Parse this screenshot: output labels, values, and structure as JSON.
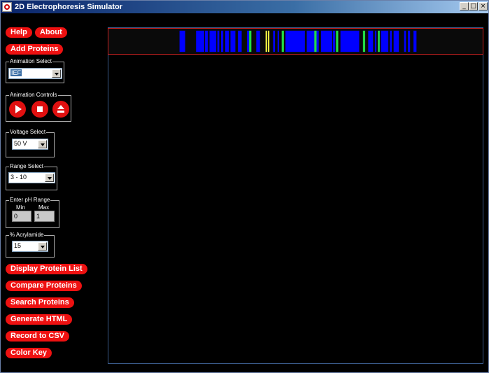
{
  "window": {
    "title": "2D Electrophoresis Simulator",
    "controls": {
      "minimize": "_",
      "maximize": "□",
      "close": "×"
    }
  },
  "sidebar": {
    "help": "Help",
    "about": "About",
    "add_proteins": "Add Proteins",
    "animation_select": {
      "label": "Animation Select",
      "value": "IEF"
    },
    "animation_controls": {
      "label": "Animation Controls",
      "play_icon": "play-icon",
      "stop_icon": "stop-icon",
      "eject_icon": "eject-icon"
    },
    "voltage_select": {
      "label": "Voltage Select",
      "value": "50 V"
    },
    "range_select": {
      "label": "Range Select",
      "value": "3 - 10"
    },
    "ph_range": {
      "label": "Enter pH Range",
      "min_label": "Min",
      "max_label": "Max",
      "min_value": "0",
      "max_value": "1"
    },
    "acrylamide": {
      "label": "% Acrylamide",
      "value": "15"
    },
    "buttons": [
      "Display Protein List",
      "Compare Proteins",
      "Search Proteins",
      "Generate HTML",
      "Record to CSV",
      "Color Key"
    ]
  },
  "colors": {
    "accent_button": "#ee1111",
    "band_blue": "#0000ff",
    "band_green": "#22dd44",
    "band_yellow": "#ffff44",
    "strip_border": "#cc2222"
  },
  "strip_bands": [
    {
      "pos": 0.19,
      "w": 0.015,
      "color": "blue"
    },
    {
      "pos": 0.234,
      "w": 0.022,
      "color": "blue"
    },
    {
      "pos": 0.258,
      "w": 0.008,
      "color": "blue"
    },
    {
      "pos": 0.27,
      "w": 0.018,
      "color": "blue"
    },
    {
      "pos": 0.291,
      "w": 0.005,
      "color": "blue"
    },
    {
      "pos": 0.301,
      "w": 0.006,
      "color": "blue"
    },
    {
      "pos": 0.312,
      "w": 0.01,
      "color": "blue"
    },
    {
      "pos": 0.326,
      "w": 0.013,
      "color": "blue"
    },
    {
      "pos": 0.346,
      "w": 0.01,
      "color": "blue"
    },
    {
      "pos": 0.37,
      "w": 0.006,
      "color": "blue"
    },
    {
      "pos": 0.376,
      "w": 0.006,
      "color": "green"
    },
    {
      "pos": 0.395,
      "w": 0.01,
      "color": "blue"
    },
    {
      "pos": 0.42,
      "w": 0.004,
      "color": "yellow"
    },
    {
      "pos": 0.426,
      "w": 0.004,
      "color": "yellow"
    },
    {
      "pos": 0.44,
      "w": 0.005,
      "color": "blue"
    },
    {
      "pos": 0.452,
      "w": 0.004,
      "color": "blue"
    },
    {
      "pos": 0.463,
      "w": 0.006,
      "color": "green"
    },
    {
      "pos": 0.473,
      "w": 0.052,
      "color": "blue"
    },
    {
      "pos": 0.53,
      "w": 0.032,
      "color": "blue"
    },
    {
      "pos": 0.55,
      "w": 0.006,
      "color": "green"
    },
    {
      "pos": 0.568,
      "w": 0.03,
      "color": "blue"
    },
    {
      "pos": 0.6,
      "w": 0.006,
      "color": "blue"
    },
    {
      "pos": 0.608,
      "w": 0.006,
      "color": "green"
    },
    {
      "pos": 0.62,
      "w": 0.05,
      "color": "blue"
    },
    {
      "pos": 0.68,
      "w": 0.006,
      "color": "green"
    },
    {
      "pos": 0.694,
      "w": 0.013,
      "color": "blue"
    },
    {
      "pos": 0.712,
      "w": 0.004,
      "color": "blue"
    },
    {
      "pos": 0.72,
      "w": 0.005,
      "color": "green"
    },
    {
      "pos": 0.728,
      "w": 0.02,
      "color": "blue"
    },
    {
      "pos": 0.752,
      "w": 0.005,
      "color": "blue"
    },
    {
      "pos": 0.762,
      "w": 0.014,
      "color": "blue"
    },
    {
      "pos": 0.79,
      "w": 0.005,
      "color": "blue"
    },
    {
      "pos": 0.8,
      "w": 0.006,
      "color": "blue"
    },
    {
      "pos": 0.815,
      "w": 0.008,
      "color": "blue"
    }
  ]
}
